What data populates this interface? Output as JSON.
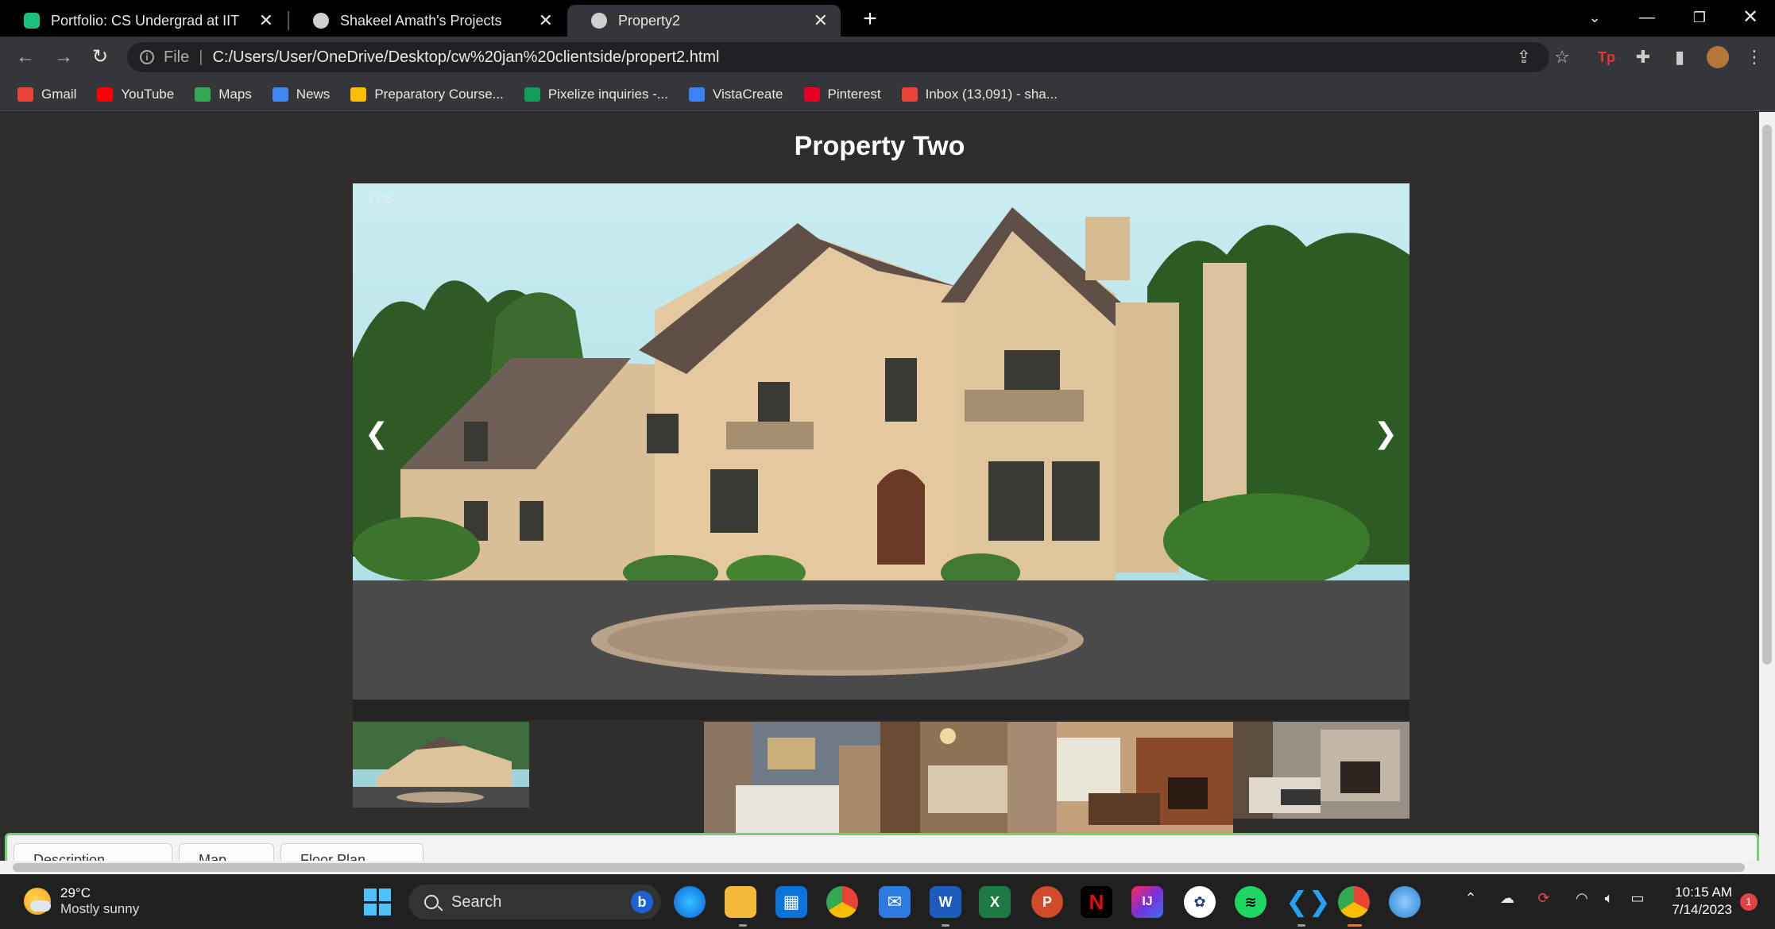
{
  "browser": {
    "tabs": [
      {
        "title": "Portfolio: CS Undergrad at IIT",
        "active": false
      },
      {
        "title": "Shakeel Amath's Projects",
        "active": false
      },
      {
        "title": "Property2",
        "active": true
      }
    ],
    "address": {
      "scheme_label": "File",
      "url": "C:/Users/User/OneDrive/Desktop/cw%20jan%20clientside/propert2.html"
    },
    "bookmarks": [
      {
        "label": "Gmail",
        "icon": "gmail-icon",
        "color": "#ea4335"
      },
      {
        "label": "YouTube",
        "icon": "youtube-icon",
        "color": "#ff0000"
      },
      {
        "label": "Maps",
        "icon": "maps-icon",
        "color": "#34a853"
      },
      {
        "label": "News",
        "icon": "news-icon",
        "color": "#4285f4"
      },
      {
        "label": "Preparatory Course...",
        "icon": "drive-icon",
        "color": "#fbbc04"
      },
      {
        "label": "Pixelize inquiries -...",
        "icon": "sheets-icon",
        "color": "#0f9d58"
      },
      {
        "label": "VistaCreate",
        "icon": "vistacreate-icon",
        "color": "#3b82f6"
      },
      {
        "label": "Pinterest",
        "icon": "pinterest-icon",
        "color": "#e60023"
      },
      {
        "label": "Inbox (13,091) - sha...",
        "icon": "gmail-icon",
        "color": "#ea4335"
      }
    ]
  },
  "page": {
    "title": "Property Two",
    "slideshow": {
      "counter": "1 / 6",
      "prev_label": "❮",
      "next_label": "❯"
    },
    "thumbnails": [
      {
        "name": "thumb-exterior"
      },
      {
        "name": "thumb-empty"
      },
      {
        "name": "thumb-bedroom-blue"
      },
      {
        "name": "thumb-bedroom-master"
      },
      {
        "name": "thumb-living-fireplace"
      },
      {
        "name": "thumb-family-room"
      }
    ],
    "tabs": [
      {
        "label": "Description"
      },
      {
        "label": "Map"
      },
      {
        "label": "Floor Plan"
      }
    ]
  },
  "taskbar": {
    "weather_temp": "29°C",
    "weather_desc": "Mostly sunny",
    "search_label": "Search",
    "time": "10:15 AM",
    "date": "7/14/2023",
    "notification_count": "1"
  }
}
